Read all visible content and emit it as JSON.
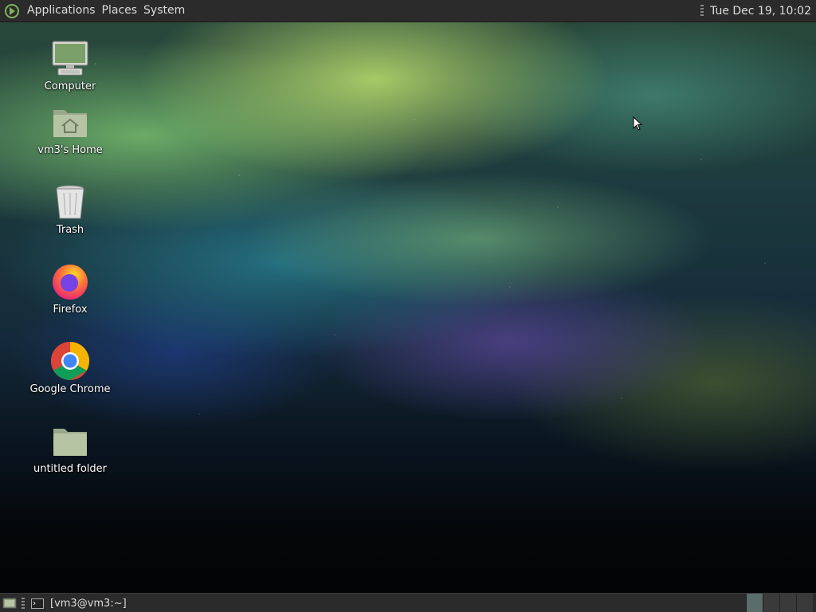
{
  "top_panel": {
    "menus": [
      "Applications",
      "Places",
      "System"
    ],
    "clock": "Tue Dec 19, 10:02"
  },
  "desktop_icons": [
    {
      "label": "Computer",
      "icon": "computer-icon"
    },
    {
      "label": "vm3's Home",
      "icon": "home-folder-icon"
    },
    {
      "label": "Trash",
      "icon": "trash-icon"
    },
    {
      "label": "Firefox",
      "icon": "firefox-icon"
    },
    {
      "label": "Google Chrome",
      "icon": "chrome-icon"
    },
    {
      "label": "untitled folder",
      "icon": "folder-icon"
    }
  ],
  "bottom_panel": {
    "task": "[vm3@vm3:~]"
  },
  "colors": {
    "panel_bg": "#2b2b2b",
    "panel_text": "#dcdcdc",
    "folder_green": "#b7c4a4",
    "workspace_active": "#5a6d6a"
  }
}
